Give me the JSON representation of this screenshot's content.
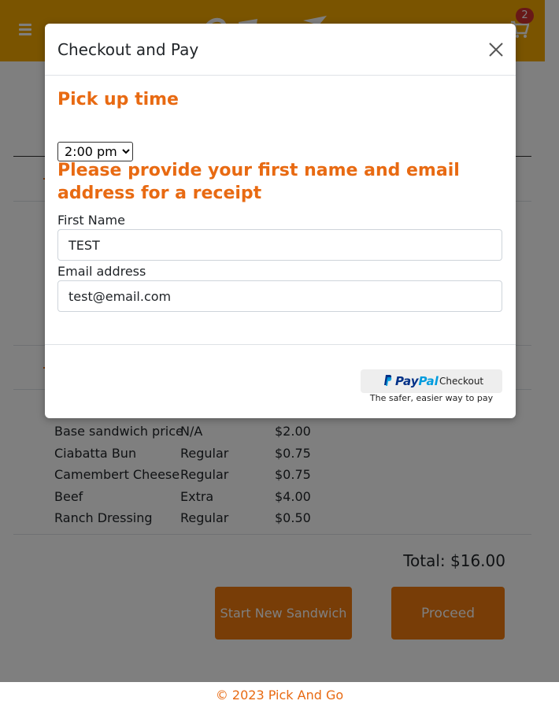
{
  "header": {
    "cart_count": "2"
  },
  "order": {
    "items": [
      {
        "name": "Base sandwich price",
        "amount": "N/A",
        "price": "$2.00"
      },
      {
        "name": "Ciabatta Bun",
        "amount": "Regular",
        "price": "$0.75"
      },
      {
        "name": "Camembert Cheese",
        "amount": "Regular",
        "price": "$0.75"
      },
      {
        "name": "Beef",
        "amount": "Extra",
        "price": "$4.00"
      },
      {
        "name": "Ranch Dressing",
        "amount": "Regular",
        "price": "$0.50"
      }
    ],
    "total": "Total: $16.00",
    "start_new_label": "Start New Sandwich",
    "proceed_label": "Proceed"
  },
  "footer": {
    "copyright": "© 2023 Pick And Go"
  },
  "modal": {
    "title": "Checkout and Pay",
    "pickup_heading": "Pick up time",
    "pickup_time": "2:00 pm",
    "receipt_heading": "Please provide your first name and email address for a receipt",
    "first_name_label": "First Name",
    "first_name_value": "TEST",
    "email_label": "Email address",
    "email_value": "test@email.com",
    "paypal": {
      "pay": "Pay",
      "pal": "Pal",
      "checkout": "Checkout",
      "tagline": "The safer, easier way to pay"
    }
  },
  "colors": {
    "brand_orange": "#e86a12",
    "header_yellow": "#f5a800",
    "button_orange": "#f07a0f",
    "paypal_dark": "#003087",
    "paypal_light": "#009cde"
  }
}
